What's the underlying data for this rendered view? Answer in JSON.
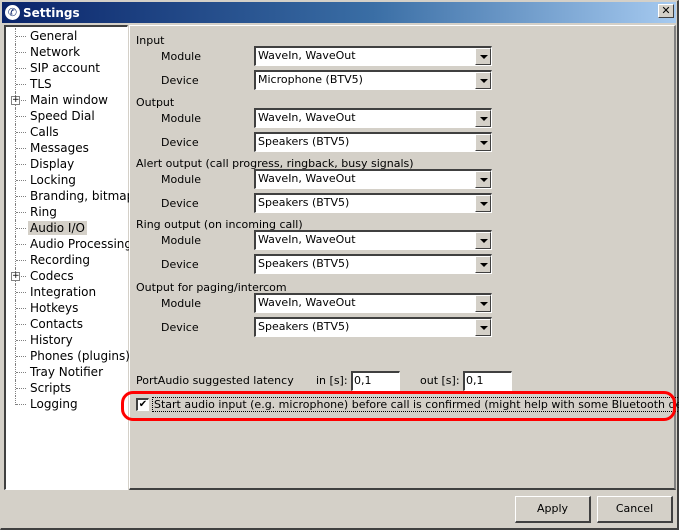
{
  "window": {
    "title": "Settings",
    "close_label": "✕"
  },
  "tree": {
    "items": [
      {
        "label": "General",
        "expandable": false
      },
      {
        "label": "Network",
        "expandable": false
      },
      {
        "label": "SIP account",
        "expandable": false
      },
      {
        "label": "TLS",
        "expandable": false
      },
      {
        "label": "Main window",
        "expandable": true
      },
      {
        "label": "Speed Dial",
        "expandable": false
      },
      {
        "label": "Calls",
        "expandable": false
      },
      {
        "label": "Messages",
        "expandable": false
      },
      {
        "label": "Display",
        "expandable": false
      },
      {
        "label": "Locking",
        "expandable": false
      },
      {
        "label": "Branding, bitmaps",
        "expandable": false
      },
      {
        "label": "Ring",
        "expandable": false
      },
      {
        "label": "Audio I/O",
        "expandable": false,
        "selected": true
      },
      {
        "label": "Audio Processing",
        "expandable": false
      },
      {
        "label": "Recording",
        "expandable": false
      },
      {
        "label": "Codecs",
        "expandable": true
      },
      {
        "label": "Integration",
        "expandable": false
      },
      {
        "label": "Hotkeys",
        "expandable": false
      },
      {
        "label": "Contacts",
        "expandable": false
      },
      {
        "label": "History",
        "expandable": false
      },
      {
        "label": "Phones (plugins)",
        "expandable": false
      },
      {
        "label": "Tray Notifier",
        "expandable": false
      },
      {
        "label": "Scripts",
        "expandable": false
      },
      {
        "label": "Logging",
        "expandable": false
      }
    ]
  },
  "audio": {
    "groups": [
      {
        "title": "Input",
        "module_label": "Module",
        "module_value": "WaveIn, WaveOut",
        "device_label": "Device",
        "device_value": "Microphone (BTV5)"
      },
      {
        "title": "Output",
        "module_label": "Module",
        "module_value": "WaveIn, WaveOut",
        "device_label": "Device",
        "device_value": "Speakers (BTV5)"
      },
      {
        "title": "Alert output (call progress, ringback, busy signals)",
        "module_label": "Module",
        "module_value": "WaveIn, WaveOut",
        "device_label": "Device",
        "device_value": "Speakers (BTV5)"
      },
      {
        "title": "Ring output (on incoming call)",
        "module_label": "Module",
        "module_value": "WaveIn, WaveOut",
        "device_label": "Device",
        "device_value": "Speakers (BTV5)"
      },
      {
        "title": "Output for paging/intercom",
        "module_label": "Module",
        "module_value": "WaveIn, WaveOut",
        "device_label": "Device",
        "device_value": "Speakers (BTV5)"
      }
    ],
    "latency": {
      "label": "PortAudio suggested latency",
      "in_label": "in [s]:",
      "in_value": "0,1",
      "out_label": "out [s]:",
      "out_value": "0,1"
    },
    "start_audio_checkbox": {
      "checked": true,
      "check_glyph": "✔",
      "label": "Start audio input (e.g. microphone) before call is confirmed (might help with some Bluetooth devices delay)"
    }
  },
  "buttons": {
    "apply": "Apply",
    "cancel": "Cancel"
  },
  "annotation": {
    "highlight_color": "#ff0000"
  }
}
